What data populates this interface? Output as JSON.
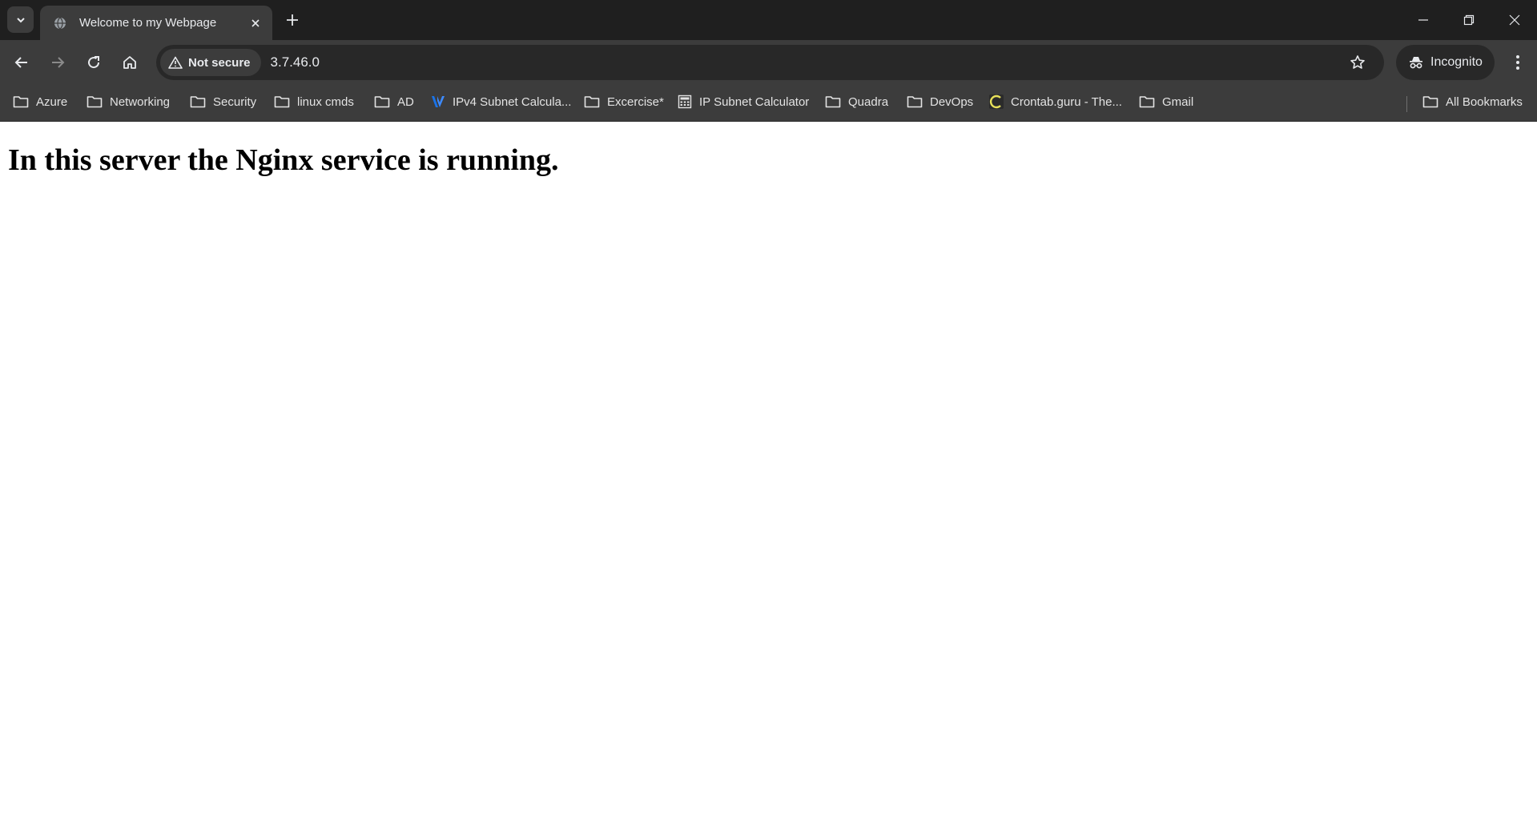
{
  "browser": {
    "tab": {
      "title": "Welcome to my Webpage"
    },
    "toolbar": {
      "security_label": "Not secure",
      "url": "3.7.46.0",
      "profile_label": "Incognito"
    },
    "bookmarks": [
      {
        "label": "Azure",
        "icon": "folder-icon"
      },
      {
        "label": "Networking",
        "icon": "folder-icon"
      },
      {
        "label": "Security",
        "icon": "folder-icon"
      },
      {
        "label": "linux cmds",
        "icon": "folder-icon"
      },
      {
        "label": "AD",
        "icon": "folder-icon"
      },
      {
        "label": "IPv4 Subnet Calcula...",
        "icon": "site-favicon-v"
      },
      {
        "label": "Excercise*",
        "icon": "folder-icon"
      },
      {
        "label": "IP Subnet Calculator",
        "icon": "calculator-icon"
      },
      {
        "label": "Quadra",
        "icon": "folder-icon"
      },
      {
        "label": "DevOps",
        "icon": "folder-icon"
      },
      {
        "label": "Crontab.guru - The...",
        "icon": "crontab-favicon"
      },
      {
        "label": "Gmail",
        "icon": "folder-icon"
      }
    ],
    "all_bookmarks_label": "All Bookmarks",
    "colors": {
      "chrome_dark": "#1f1f1f",
      "toolbar": "#3c3c3c",
      "text": "#e8eaed",
      "accent_blue": "#1a73e8",
      "crontab_yellow": "#e8e15a"
    }
  },
  "page": {
    "heading": "In this server the Nginx service is running."
  }
}
